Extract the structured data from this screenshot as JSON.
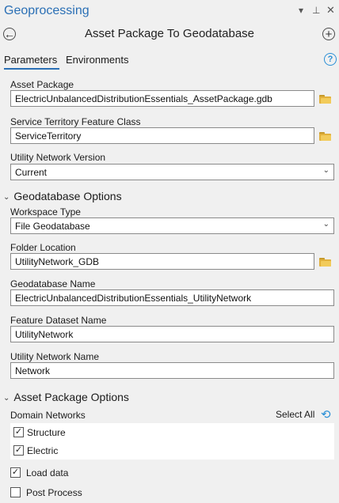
{
  "pane": {
    "title": "Geoprocessing",
    "icons": {
      "dropdown": "chevron-down-icon",
      "pin": "pin-icon",
      "close": "close-icon"
    }
  },
  "tool": {
    "title": "Asset Package To Geodatabase",
    "back_icon": "back-arrow-icon",
    "add_icon": "add-icon"
  },
  "tabs": [
    {
      "label": "Parameters",
      "active": true
    },
    {
      "label": "Environments",
      "active": false
    }
  ],
  "help_icon": "?",
  "params": {
    "asset_package": {
      "label": "Asset Package",
      "value": "ElectricUnbalancedDistributionEssentials_AssetPackage.gdb"
    },
    "service_territory": {
      "label": "Service Territory Feature Class",
      "value": "ServiceTerritory"
    },
    "un_version": {
      "label": "Utility Network Version",
      "value": "Current"
    }
  },
  "geodatabase_options": {
    "title": "Geodatabase Options",
    "workspace_type": {
      "label": "Workspace Type",
      "value": "File Geodatabase"
    },
    "folder_location": {
      "label": "Folder Location",
      "value": "UtilityNetwork_GDB"
    },
    "gdb_name": {
      "label": "Geodatabase Name",
      "value": "ElectricUnbalancedDistributionEssentials_UtilityNetwork"
    },
    "fd_name": {
      "label": "Feature Dataset Name",
      "value": "UtilityNetwork"
    },
    "un_name": {
      "label": "Utility Network Name",
      "value": "Network"
    }
  },
  "asset_package_options": {
    "title": "Asset Package Options",
    "domain_networks": {
      "label": "Domain Networks",
      "select_all": "Select All",
      "items": [
        {
          "label": "Structure",
          "checked": true
        },
        {
          "label": "Electric",
          "checked": true
        }
      ]
    },
    "load_data": {
      "label": "Load data",
      "checked": true
    },
    "post_process": {
      "label": "Post Process",
      "checked": false
    }
  },
  "colors": {
    "accent": "#2a6fb5",
    "folder": "#e2b13c",
    "background": "#f0f0f0"
  }
}
